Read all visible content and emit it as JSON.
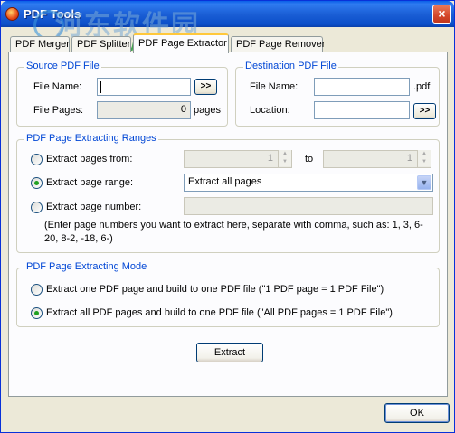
{
  "window": {
    "title": "PDF Tools",
    "close_glyph": "×"
  },
  "watermark": {
    "text": "河东软件园",
    "url": "www.pc0359.cn"
  },
  "tabs": [
    {
      "label": "PDF Merger",
      "active": false
    },
    {
      "label": "PDF Splitter",
      "active": false
    },
    {
      "label": "PDF Page Extractor",
      "active": true
    },
    {
      "label": "PDF Page Remover",
      "active": false
    }
  ],
  "source": {
    "title": "Source PDF File",
    "file_name_label": "File Name:",
    "file_name_value": "",
    "browse_label": ">>",
    "file_pages_label": "File Pages:",
    "file_pages_value": "0",
    "pages_unit": "pages"
  },
  "destination": {
    "title": "Destination PDF File",
    "file_name_label": "File Name:",
    "file_name_value": "",
    "ext": ".pdf",
    "location_label": "Location:",
    "location_value": "",
    "browse_label": ">>"
  },
  "ranges": {
    "title": "PDF Page Extracting Ranges",
    "pages_from_label": "Extract pages from:",
    "from_value": "1",
    "to_label": "to",
    "to_value": "1",
    "page_range_label": "Extract page range:",
    "page_range_selected": "Extract all pages",
    "page_number_label": "Extract page number:",
    "page_number_value": "",
    "note": "(Enter page numbers you want to extract here, separate with comma,  such as: 1, 3, 6-20, 8-2, -18, 6-)",
    "selected_option": "page_range"
  },
  "mode": {
    "title": "PDF Page Extracting Mode",
    "option1": "Extract one PDF page and build to one PDF file (\"1 PDF page = 1 PDF File\")",
    "option2": "Extract all PDF pages and build to one PDF file (\"All PDF pages = 1 PDF File\")",
    "selected_option": "option2"
  },
  "extract_button": "Extract",
  "ok_button": "OK",
  "colors": {
    "title_bar": "#0a5fe8",
    "group_title": "#0046d5",
    "radio_dot": "#21a121",
    "active_tab_accent": "#ffc83c"
  }
}
